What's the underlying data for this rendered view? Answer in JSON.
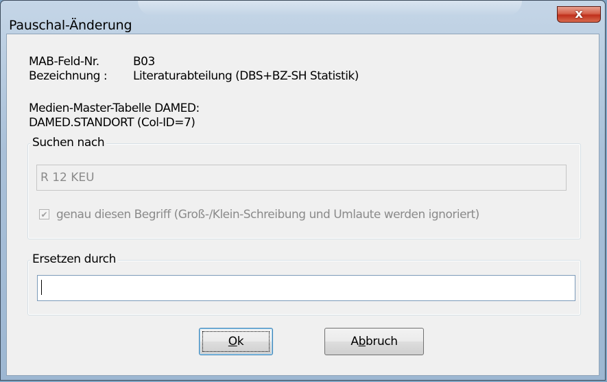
{
  "window": {
    "title": "Pauschal-Änderung",
    "close_symbol": "x"
  },
  "info": {
    "mab_label": "MAB-Feld-Nr.",
    "mab_value": "B03",
    "bez_label": "Bezeichnung :",
    "bez_value": "Literaturabteilung (DBS+BZ-SH Statistik)",
    "table_line1": "Medien-Master-Tabelle DAMED:",
    "table_line2": "DAMED.STANDORT (Col-ID=7)"
  },
  "search": {
    "group_label": "Suchen nach",
    "value": "R 12 KEU",
    "checkbox_checked": true,
    "checkbox_label": "genau diesen Begriff (Groß-/Klein-Schreibung und Umlaute werden ignoriert)"
  },
  "replace": {
    "group_label": "Ersetzen durch",
    "value": ""
  },
  "buttons": {
    "ok_accel": "O",
    "ok_rest": "k",
    "cancel_pre": "A",
    "cancel_accel": "b",
    "cancel_rest": "bruch"
  },
  "colors": {
    "close_button": "#c7432b",
    "dialog_background": "#f0f0f0",
    "default_button_border": "#3c7fb1"
  },
  "icons": {
    "close": "close-icon",
    "checkbox": "checkmark-icon"
  }
}
